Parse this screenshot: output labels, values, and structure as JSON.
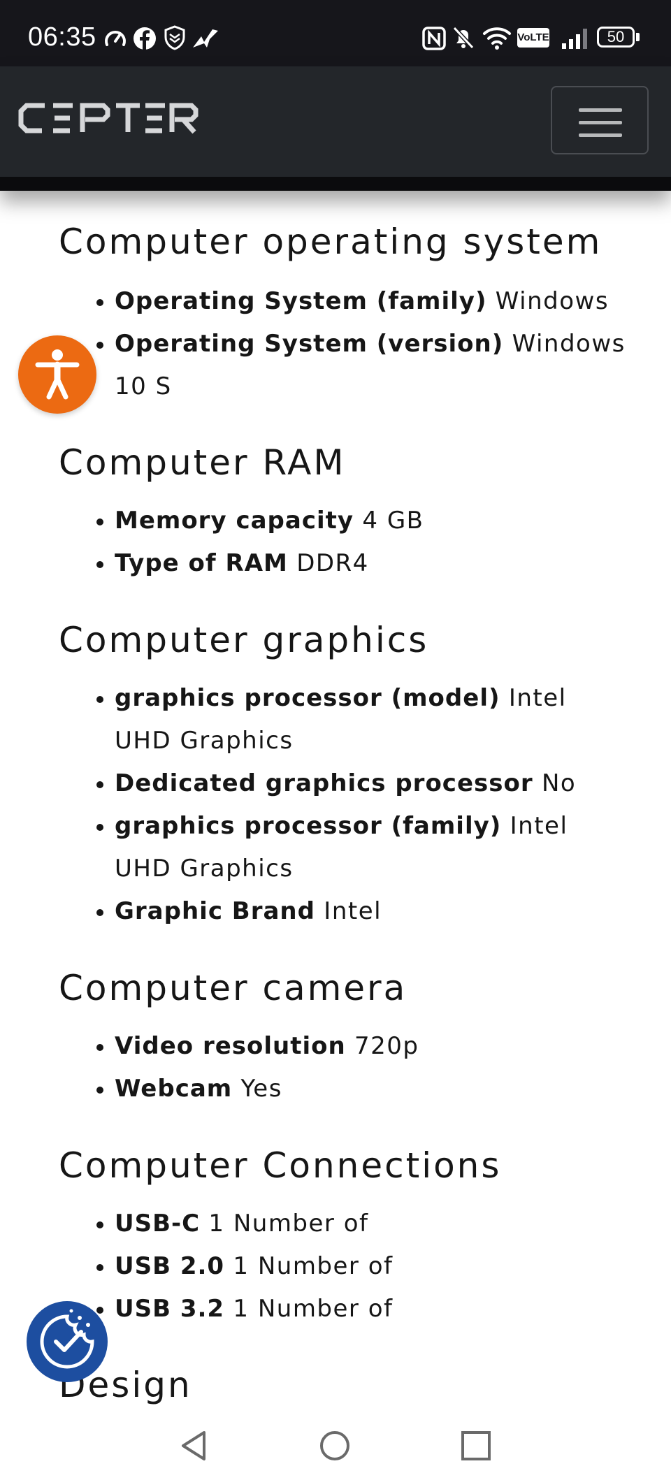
{
  "status_bar": {
    "time": "06:35",
    "left_icons": [
      "speedometer-icon",
      "facebook-icon",
      "shield-icon",
      "bird-icon"
    ],
    "right_icons": [
      "nfc-icon",
      "bell-muted-icon",
      "wifi-icon",
      "volte-icon",
      "signal-icon",
      "battery-icon"
    ],
    "volte_label": "VoLTE",
    "battery": "50"
  },
  "header": {
    "logo_alt": "CEPTER",
    "menu_icon": "hamburger-icon"
  },
  "sections": [
    {
      "title": "Computer operating system",
      "items": [
        {
          "label": "Operating System (family)",
          "value": "Windows"
        },
        {
          "label": "Operating System (version)",
          "value": "Windows 10 S"
        }
      ]
    },
    {
      "title": "Computer RAM",
      "items": [
        {
          "label": "Memory capacity",
          "value": "4 GB"
        },
        {
          "label": "Type of RAM",
          "value": "DDR4"
        }
      ]
    },
    {
      "title": "Computer graphics",
      "items": [
        {
          "label": "graphics processor (model)",
          "value": "Intel UHD Graphics"
        },
        {
          "label": "Dedicated graphics processor",
          "value": "No"
        },
        {
          "label": "graphics processor (family)",
          "value": "Intel UHD Graphics"
        },
        {
          "label": "Graphic Brand",
          "value": "Intel"
        }
      ]
    },
    {
      "title": "Computer camera",
      "items": [
        {
          "label": "Video resolution",
          "value": "720p"
        },
        {
          "label": "Webcam",
          "value": "Yes"
        }
      ]
    },
    {
      "title": "Computer Connections",
      "items": [
        {
          "label": "USB-C",
          "value": "1 Number of"
        },
        {
          "label": "USB 2.0",
          "value": "1 Number of"
        },
        {
          "label": "USB 3.2",
          "value": "1 Number of"
        }
      ]
    },
    {
      "title": "Design",
      "items": []
    }
  ],
  "floating": {
    "accessibility_icon": "accessibility-person-icon",
    "cookie_icon": "cookie-consent-icon"
  },
  "system_nav": [
    "back-icon",
    "home-icon",
    "recents-icon"
  ],
  "colors": {
    "status_bg": "#16161b",
    "navbar_bg": "#23262a",
    "accessibility": "#ec6a12",
    "cookie": "#1d4ea0"
  }
}
